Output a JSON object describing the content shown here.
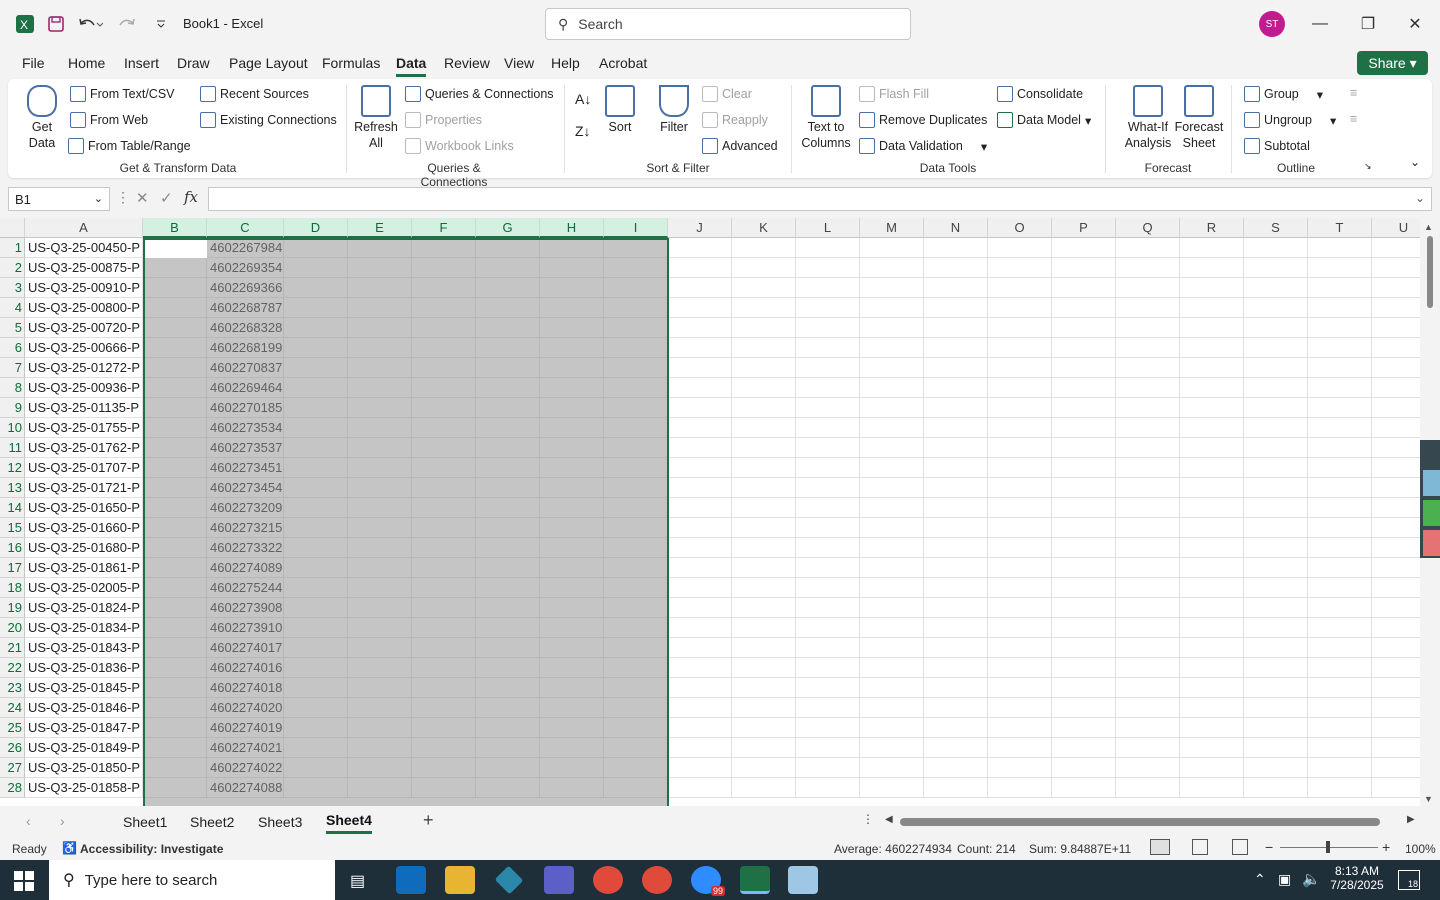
{
  "titlebar": {
    "doc_title": "Book1  -  Excel",
    "search_placeholder": "Search",
    "avatar_initials": "ST"
  },
  "menu": [
    "File",
    "Home",
    "Insert",
    "Draw",
    "Page Layout",
    "Formulas",
    "Data",
    "Review",
    "View",
    "Help",
    "Acrobat"
  ],
  "share_label": "Share",
  "ribbon": {
    "get_data": "Get Data",
    "from_text_csv": "From Text/CSV",
    "from_web": "From Web",
    "from_table_range": "From Table/Range",
    "recent_sources": "Recent Sources",
    "existing_connections": "Existing Connections",
    "group_get_transform": "Get & Transform Data",
    "refresh_all": "Refresh All",
    "queries_connections": "Queries & Connections",
    "properties": "Properties",
    "workbook_links": "Workbook Links",
    "group_queries": "Queries & Connections",
    "sort": "Sort",
    "filter": "Filter",
    "clear": "Clear",
    "reapply": "Reapply",
    "advanced": "Advanced",
    "group_sort_filter": "Sort & Filter",
    "text_to_columns": "Text to Columns",
    "flash_fill": "Flash Fill",
    "remove_duplicates": "Remove Duplicates",
    "data_validation": "Data Validation",
    "consolidate": "Consolidate",
    "data_model": "Data Model",
    "group_data_tools": "Data Tools",
    "what_if": "What-If Analysis",
    "forecast_sheet": "Forecast Sheet",
    "group_forecast": "Forecast",
    "group": "Group",
    "ungroup": "Ungroup",
    "subtotal": "Subtotal",
    "group_outline": "Outline"
  },
  "namebox": "B1",
  "columns": [
    "A",
    "B",
    "C",
    "D",
    "E",
    "F",
    "G",
    "H",
    "I",
    "J",
    "K",
    "L",
    "M",
    "N",
    "O",
    "P",
    "Q",
    "R",
    "S",
    "T",
    "U"
  ],
  "rows": [
    {
      "n": "1",
      "a": "US-Q3-25-00450-P",
      "c": "4602267984"
    },
    {
      "n": "2",
      "a": "US-Q3-25-00875-P",
      "c": "4602269354"
    },
    {
      "n": "3",
      "a": "US-Q3-25-00910-P",
      "c": "4602269366"
    },
    {
      "n": "4",
      "a": "US-Q3-25-00800-P",
      "c": "4602268787"
    },
    {
      "n": "5",
      "a": "US-Q3-25-00720-P",
      "c": "4602268328"
    },
    {
      "n": "6",
      "a": "US-Q3-25-00666-P",
      "c": "4602268199"
    },
    {
      "n": "7",
      "a": "US-Q3-25-01272-P",
      "c": "4602270837"
    },
    {
      "n": "8",
      "a": "US-Q3-25-00936-P",
      "c": "4602269464"
    },
    {
      "n": "9",
      "a": "US-Q3-25-01135-P",
      "c": "4602270185"
    },
    {
      "n": "10",
      "a": "US-Q3-25-01755-P",
      "c": "4602273534"
    },
    {
      "n": "11",
      "a": "US-Q3-25-01762-P",
      "c": "4602273537"
    },
    {
      "n": "12",
      "a": "US-Q3-25-01707-P",
      "c": "4602273451"
    },
    {
      "n": "13",
      "a": "US-Q3-25-01721-P",
      "c": "4602273454"
    },
    {
      "n": "14",
      "a": "US-Q3-25-01650-P",
      "c": "4602273209"
    },
    {
      "n": "15",
      "a": "US-Q3-25-01660-P",
      "c": "4602273215"
    },
    {
      "n": "16",
      "a": "US-Q3-25-01680-P",
      "c": "4602273322"
    },
    {
      "n": "17",
      "a": "US-Q3-25-01861-P",
      "c": "4602274089"
    },
    {
      "n": "18",
      "a": "US-Q3-25-02005-P",
      "c": "4602275244"
    },
    {
      "n": "19",
      "a": "US-Q3-25-01824-P",
      "c": "4602273908"
    },
    {
      "n": "20",
      "a": "US-Q3-25-01834-P",
      "c": "4602273910"
    },
    {
      "n": "21",
      "a": "US-Q3-25-01843-P",
      "c": "4602274017"
    },
    {
      "n": "22",
      "a": "US-Q3-25-01836-P",
      "c": "4602274016"
    },
    {
      "n": "23",
      "a": "US-Q3-25-01845-P",
      "c": "4602274018"
    },
    {
      "n": "24",
      "a": "US-Q3-25-01846-P",
      "c": "4602274020"
    },
    {
      "n": "25",
      "a": "US-Q3-25-01847-P",
      "c": "4602274019"
    },
    {
      "n": "26",
      "a": "US-Q3-25-01849-P",
      "c": "4602274021"
    },
    {
      "n": "27",
      "a": "US-Q3-25-01850-P",
      "c": "4602274022"
    },
    {
      "n": "28",
      "a": "US-Q3-25-01858-P",
      "c": "4602274088"
    }
  ],
  "sheets": [
    "Sheet1",
    "Sheet2",
    "Sheet3",
    "Sheet4"
  ],
  "active_sheet": "Sheet4",
  "status": {
    "ready": "Ready",
    "accessibility": "Accessibility: Investigate",
    "average": "Average: 4602274934",
    "count": "Count: 214",
    "sum": "Sum: 9.84887E+11",
    "zoom": "100%"
  },
  "taskbar": {
    "search_placeholder": "Type here to search",
    "time": "8:13 AM",
    "date": "7/28/2025",
    "notif_count": "18",
    "zoom_badge": "99"
  },
  "colors": {
    "excel_green": "#1e7145",
    "selection": "#9a9a9a",
    "taskbar": "#1f2f3a"
  }
}
